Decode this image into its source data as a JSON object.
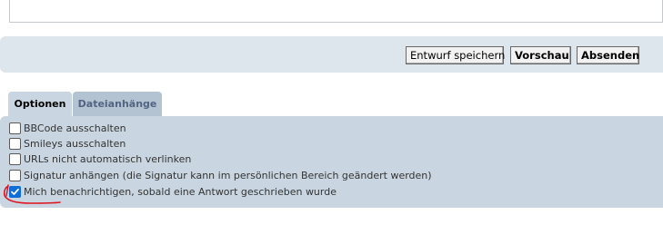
{
  "editor": {
    "buttons": {
      "draft_label": "Entwurf speichern",
      "preview_label": "Vorschau",
      "submit_label": "Absenden"
    }
  },
  "tabs": [
    {
      "label": "Optionen",
      "active": true
    },
    {
      "label": "Dateianhänge",
      "active": false
    }
  ],
  "options": [
    {
      "label": "BBCode ausschalten",
      "checked": false
    },
    {
      "label": "Smileys ausschalten",
      "checked": false
    },
    {
      "label": "URLs nicht automatisch verlinken",
      "checked": false
    },
    {
      "label": "Signatur anhängen (die Signatur kann im persönlichen Bereich geändert werden)",
      "checked": false
    },
    {
      "label": "Mich benachrichtigen, sobald eine Antwort geschrieben wurde",
      "checked": true
    }
  ],
  "annotation": {
    "color": "#e0141e",
    "marks": "red-checkbox-highlight"
  },
  "colors": {
    "panel_bg": "#dde6ed",
    "options_bg": "#c9d6e1",
    "inactive_tab_bg": "#b3c3d1",
    "inactive_tab_text": "#536482",
    "checkbox_checked": "#0f6ed6"
  }
}
